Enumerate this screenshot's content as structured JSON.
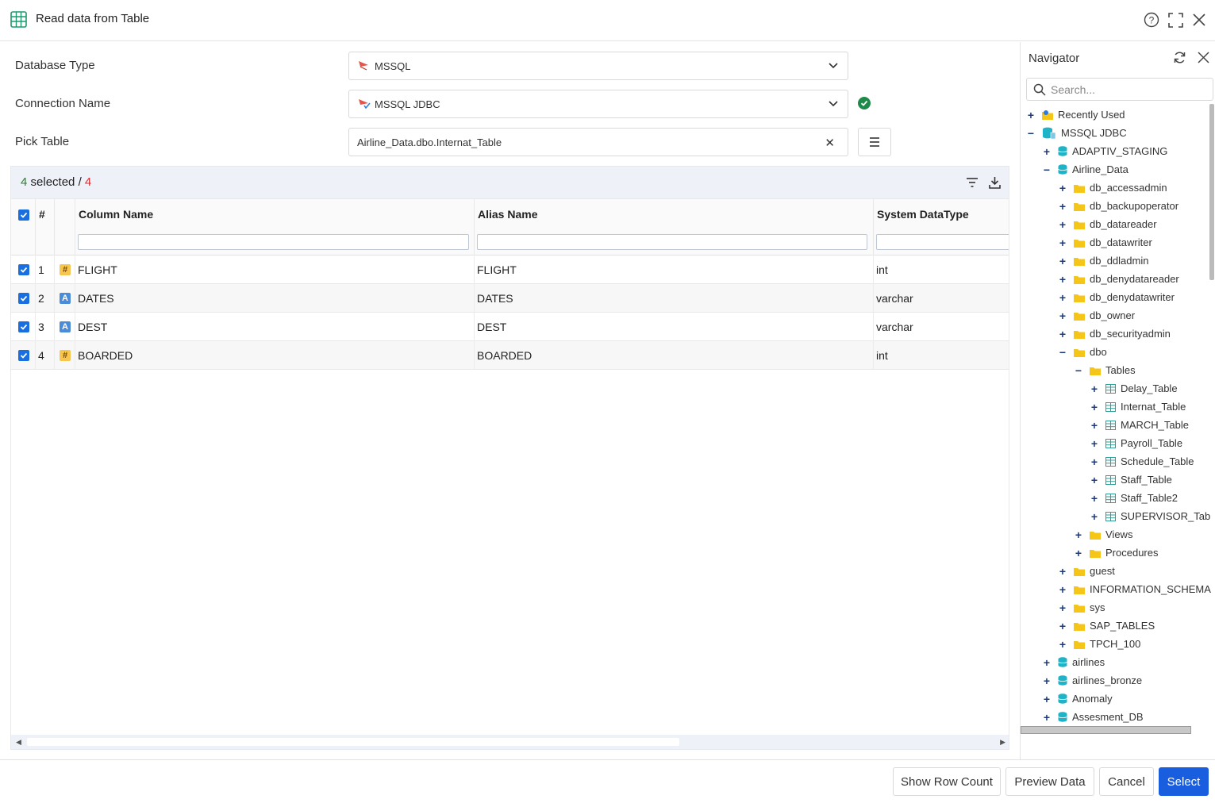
{
  "dialog": {
    "title": "Read data from Table",
    "icon": "table-icon"
  },
  "form": {
    "database_type": {
      "label": "Database Type",
      "value": "MSSQL"
    },
    "connection_name": {
      "label": "Connection Name",
      "value": "MSSQL JDBC",
      "status": "connected"
    },
    "pick_table": {
      "label": "Pick Table",
      "value": "Airline_Data.dbo.Internat_Table",
      "clear": "✕"
    }
  },
  "grid": {
    "selected_count": "4",
    "selected_text": "selected",
    "separator": "/",
    "total_count": "4",
    "headers": {
      "check": "",
      "index": "#",
      "type": "",
      "column_name": "Column Name",
      "alias_name": "Alias Name",
      "system_datatype": "System DataType"
    },
    "rows": [
      {
        "index": "1",
        "type": "#",
        "type_kind": "numeric",
        "column_name": "FLIGHT",
        "alias_name": "FLIGHT",
        "system_datatype": "int"
      },
      {
        "index": "2",
        "type": "A",
        "type_kind": "string",
        "column_name": "DATES",
        "alias_name": "DATES",
        "system_datatype": "varchar"
      },
      {
        "index": "3",
        "type": "A",
        "type_kind": "string",
        "column_name": "DEST",
        "alias_name": "DEST",
        "system_datatype": "varchar"
      },
      {
        "index": "4",
        "type": "#",
        "type_kind": "numeric",
        "column_name": "BOARDED",
        "alias_name": "BOARDED",
        "system_datatype": "int"
      }
    ]
  },
  "navigator": {
    "title": "Navigator",
    "search_placeholder": "Search...",
    "tree": [
      {
        "label": "Recently Used",
        "toggle": "+",
        "icon": "star-folder-icon"
      },
      {
        "label": "MSSQL JDBC",
        "toggle": "−",
        "icon": "database-server-icon"
      },
      {
        "label": "ADAPTIV_STAGING",
        "toggle": "+",
        "icon": "database-icon"
      },
      {
        "label": "Airline_Data",
        "toggle": "−",
        "icon": "database-icon"
      },
      {
        "label": "db_accessadmin",
        "toggle": "+",
        "icon": "folder-icon"
      },
      {
        "label": "db_backupoperator",
        "toggle": "+",
        "icon": "folder-icon"
      },
      {
        "label": "db_datareader",
        "toggle": "+",
        "icon": "folder-icon"
      },
      {
        "label": "db_datawriter",
        "toggle": "+",
        "icon": "folder-icon"
      },
      {
        "label": "db_ddladmin",
        "toggle": "+",
        "icon": "folder-icon"
      },
      {
        "label": "db_denydatareader",
        "toggle": "+",
        "icon": "folder-icon"
      },
      {
        "label": "db_denydatawriter",
        "toggle": "+",
        "icon": "folder-icon"
      },
      {
        "label": "db_owner",
        "toggle": "+",
        "icon": "folder-icon"
      },
      {
        "label": "db_securityadmin",
        "toggle": "+",
        "icon": "folder-icon"
      },
      {
        "label": "dbo",
        "toggle": "−",
        "icon": "folder-icon"
      },
      {
        "label": "Tables",
        "toggle": "−",
        "icon": "folder-icon"
      },
      {
        "label": "Delay_Table",
        "toggle": "+",
        "icon": "table-icon"
      },
      {
        "label": "Internat_Table",
        "toggle": "+",
        "icon": "table-icon"
      },
      {
        "label": "MARCH_Table",
        "toggle": "+",
        "icon": "table-icon"
      },
      {
        "label": "Payroll_Table",
        "toggle": "+",
        "icon": "table-icon"
      },
      {
        "label": "Schedule_Table",
        "toggle": "+",
        "icon": "table-icon"
      },
      {
        "label": "Staff_Table",
        "toggle": "+",
        "icon": "table-icon"
      },
      {
        "label": "Staff_Table2",
        "toggle": "+",
        "icon": "table-icon"
      },
      {
        "label": "SUPERVISOR_Table",
        "toggle": "+",
        "icon": "table-icon"
      },
      {
        "label": "Views",
        "toggle": "+",
        "icon": "folder-icon"
      },
      {
        "label": "Procedures",
        "toggle": "+",
        "icon": "folder-icon"
      },
      {
        "label": "guest",
        "toggle": "+",
        "icon": "folder-icon"
      },
      {
        "label": "INFORMATION_SCHEMA",
        "toggle": "+",
        "icon": "folder-icon"
      },
      {
        "label": "sys",
        "toggle": "+",
        "icon": "folder-icon"
      },
      {
        "label": "SAP_TABLES",
        "toggle": "+",
        "icon": "folder-icon"
      },
      {
        "label": "TPCH_100",
        "toggle": "+",
        "icon": "folder-icon"
      },
      {
        "label": "airlines",
        "toggle": "+",
        "icon": "database-icon"
      },
      {
        "label": "airlines_bronze",
        "toggle": "+",
        "icon": "database-icon"
      },
      {
        "label": "Anomaly",
        "toggle": "+",
        "icon": "database-icon"
      },
      {
        "label": "Assesment_DB",
        "toggle": "+",
        "icon": "database-icon"
      }
    ]
  },
  "footer": {
    "show_row_count": "Show Row Count",
    "preview_data": "Preview Data",
    "cancel": "Cancel",
    "select": "Select"
  },
  "colors": {
    "primary": "#1a5ee0",
    "selected_count": "#2e7d32",
    "total_count": "#d32f2f",
    "folder": "#f5c518",
    "database": "#1fb3c8",
    "table": "#2aa198"
  }
}
